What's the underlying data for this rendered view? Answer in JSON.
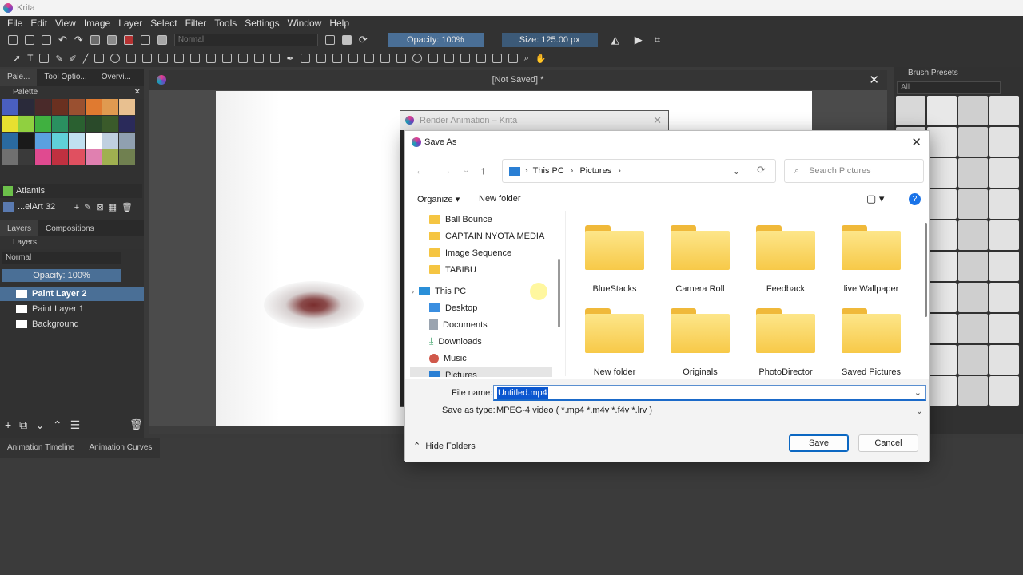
{
  "app": {
    "title": "Krita",
    "menu": [
      "File",
      "Edit",
      "View",
      "Image",
      "Layer",
      "Select",
      "Filter",
      "Tools",
      "Settings",
      "Window",
      "Help"
    ],
    "blend_mode": "Normal",
    "opacity_label": "Opacity: 100%",
    "opacity_value": 1.0,
    "size_label": "Size: 125.00 px",
    "document_tab": "[Not Saved]  *"
  },
  "left_dock": {
    "tabs": [
      "Pale...",
      "Tool Optio...",
      "Overvi..."
    ],
    "palette_title": "Palette",
    "palette_name": "Atlantis",
    "palette_set": "...elArt 32",
    "swatches": [
      "#4a5fc0",
      "#2a2a3a",
      "#4a2a2a",
      "#6a3020",
      "#9a5030",
      "#e07a30",
      "#e09a50",
      "#e8c090",
      "#e8e030",
      "#90d040",
      "#40b040",
      "#2a9060",
      "#2a6030",
      "#2a4a2a",
      "#3a5a2a",
      "#2a2a5a",
      "#2a6aa0",
      "#1a1a1a",
      "#5aa0e0",
      "#60d0d8",
      "#c0e0f0",
      "#ffffff",
      "#c0d0e0",
      "#90a0b0",
      "#707070",
      "#3a3a3a",
      "#e04a90",
      "#c03040",
      "#e05060",
      "#e080b0",
      "#a0b050",
      "#708050"
    ],
    "layers_tabs": [
      "Layers",
      "Compositions"
    ],
    "layers_title": "Layers",
    "layers_blend": "Normal",
    "layers_opacity": "Opacity:  100%",
    "layers": [
      "Paint Layer 2",
      "Paint Layer 1",
      "Background"
    ]
  },
  "right_dock": {
    "title": "Brush Presets",
    "filter": "All"
  },
  "timeline": {
    "tabs": [
      "Animation Timeline",
      "Animation Curves"
    ]
  },
  "render_dialog": {
    "title": "Render Animation – Krita"
  },
  "save_dialog": {
    "title": "Save As",
    "breadcrumb": [
      "This PC",
      "Pictures"
    ],
    "search_placeholder": "Search Pictures",
    "organize": "Organize",
    "new_folder": "New folder",
    "tree": {
      "folders": [
        "Ball Bounce",
        "CAPTAIN NYOTA MEDIA",
        "Image Sequence",
        "TABIBU"
      ],
      "this_pc": "This PC",
      "locations": [
        "Desktop",
        "Documents",
        "Downloads",
        "Music",
        "Pictures"
      ]
    },
    "files": [
      "BlueStacks",
      "Camera Roll",
      "Feedback",
      "live Wallpaper",
      "New folder",
      "Originals",
      "PhotoDirector",
      "Saved Pictures"
    ],
    "file_name_label": "File name:",
    "file_name": "Untitled.mp4",
    "save_type_label": "Save as type:",
    "save_type": "MPEG-4 video ( *.mp4 *.m4v *.f4v *.lrv )",
    "hide_folders": "Hide Folders",
    "save": "Save",
    "cancel": "Cancel"
  }
}
